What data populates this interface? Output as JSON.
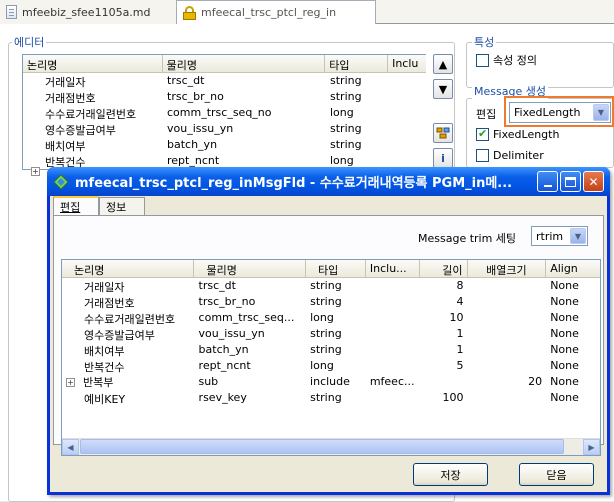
{
  "tabs": [
    {
      "label": "mfeebiz_sfee1105a.md"
    },
    {
      "label": "mfeecal_trsc_ptcl_reg_in"
    }
  ],
  "editor": {
    "group_label": "에디터",
    "columns": [
      "논리명",
      "물리명",
      "타입",
      "Inclu"
    ],
    "rows": [
      {
        "logical": "거래일자",
        "physical": "trsc_dt",
        "type": "string",
        "include": ""
      },
      {
        "logical": "거래점번호",
        "physical": "trsc_br_no",
        "type": "string",
        "include": ""
      },
      {
        "logical": "수수료거래일련번호",
        "physical": "comm_trsc_seq_no",
        "type": "long",
        "include": ""
      },
      {
        "logical": "영수증발급여부",
        "physical": "vou_issu_yn",
        "type": "string",
        "include": ""
      },
      {
        "logical": "배치여부",
        "physical": "batch_yn",
        "type": "string",
        "include": ""
      },
      {
        "logical": "반복건수",
        "physical": "rept_ncnt",
        "type": "long",
        "include": ""
      }
    ]
  },
  "properties": {
    "group_label": "특성",
    "attribute_def_label": "속성 정의",
    "message_group_label": "Message 생성",
    "edit_label": "편집",
    "edit_value": "FixedLength",
    "fixedlength_label": "FixedLength",
    "delimiter_label": "Delimiter"
  },
  "dialog": {
    "title": "mfeecal_trsc_ptcl_reg_inMsgFld - 수수료거래내역등록 PGM_in메...",
    "tabs": [
      "편집",
      "정보"
    ],
    "trim_label": "Message trim 세팅",
    "trim_value": "rtrim",
    "columns": [
      "논리명",
      "물리명",
      "타입",
      "Inclu...",
      "길이",
      "배열크기",
      "Align"
    ],
    "rows": [
      {
        "logical": "거래일자",
        "physical": "trsc_dt",
        "type": "string",
        "include": "",
        "length": "8",
        "array": "",
        "align": "None"
      },
      {
        "logical": "거래점번호",
        "physical": "trsc_br_no",
        "type": "string",
        "include": "",
        "length": "4",
        "array": "",
        "align": "None"
      },
      {
        "logical": "수수료거래일련번호",
        "physical": "comm_trsc_seq...",
        "type": "long",
        "include": "",
        "length": "10",
        "array": "",
        "align": "None"
      },
      {
        "logical": "영수증발급여부",
        "physical": "vou_issu_yn",
        "type": "string",
        "include": "",
        "length": "1",
        "array": "",
        "align": "None"
      },
      {
        "logical": "배치여부",
        "physical": "batch_yn",
        "type": "string",
        "include": "",
        "length": "1",
        "array": "",
        "align": "None"
      },
      {
        "logical": "반복건수",
        "physical": "rept_ncnt",
        "type": "long",
        "include": "",
        "length": "5",
        "array": "",
        "align": "None"
      },
      {
        "logical": "반복부",
        "physical": "sub",
        "type": "include",
        "include": "mfeec...",
        "length": "",
        "array": "20",
        "align": "None"
      },
      {
        "logical": "예비KEY",
        "physical": "rsev_key",
        "type": "string",
        "include": "",
        "length": "100",
        "array": "",
        "align": "None"
      }
    ],
    "save_label": "저장",
    "close_label": "닫음"
  }
}
